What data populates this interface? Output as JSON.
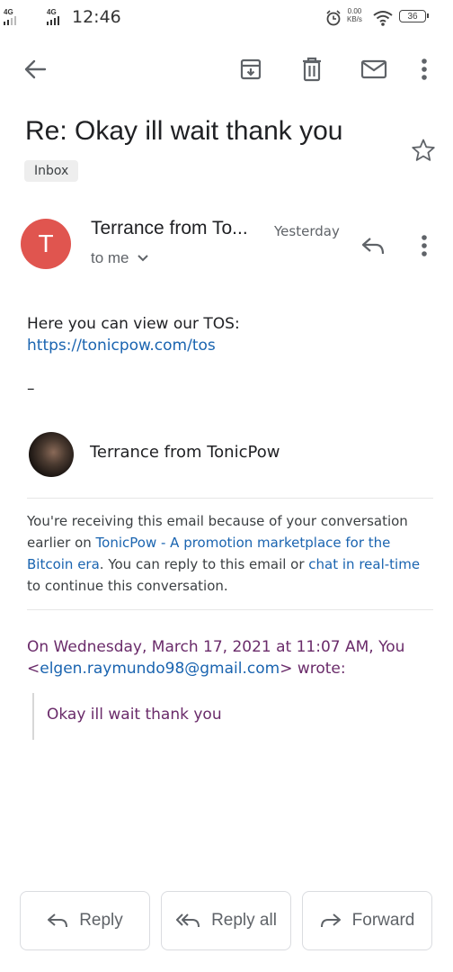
{
  "status_bar": {
    "network_1": "4G",
    "network_2": "4G",
    "time": "12:46",
    "speed_value": "0.00",
    "speed_unit": "KB/s",
    "battery": "36"
  },
  "email": {
    "subject": "Re: Okay ill wait thank you",
    "label": "Inbox",
    "avatar_letter": "T",
    "avatar_color": "#e0554f",
    "sender": "Terrance from To...",
    "date": "Yesterday",
    "recipient": "to me",
    "body_line": "Here you can view our TOS:",
    "tos_link": "https://tonicpow.com/tos",
    "signature_dash": "–",
    "footer_name": "Terrance from TonicPow",
    "footer_p1": "You're receiving this email because of your conversation earlier on ",
    "footer_link1": "TonicPow - A promotion marketplace for the Bitcoin era",
    "footer_p2": ". You can reply to this email or ",
    "footer_link2": "chat in real-time",
    "footer_p3": " to continue this conversation.",
    "quote_head_1": "On Wednesday, March 17, 2021 at 11:07 AM, You",
    "quote_email": "elgen.raymundo98@gmail.com",
    "quote_head_2": "wrote:",
    "quote_text": "Okay ill wait thank you"
  },
  "actions": {
    "reply": "Reply",
    "reply_all": "Reply all",
    "forward": "Forward"
  },
  "colors": {
    "link": "#1a64b0",
    "quote": "#6a2b6a"
  }
}
